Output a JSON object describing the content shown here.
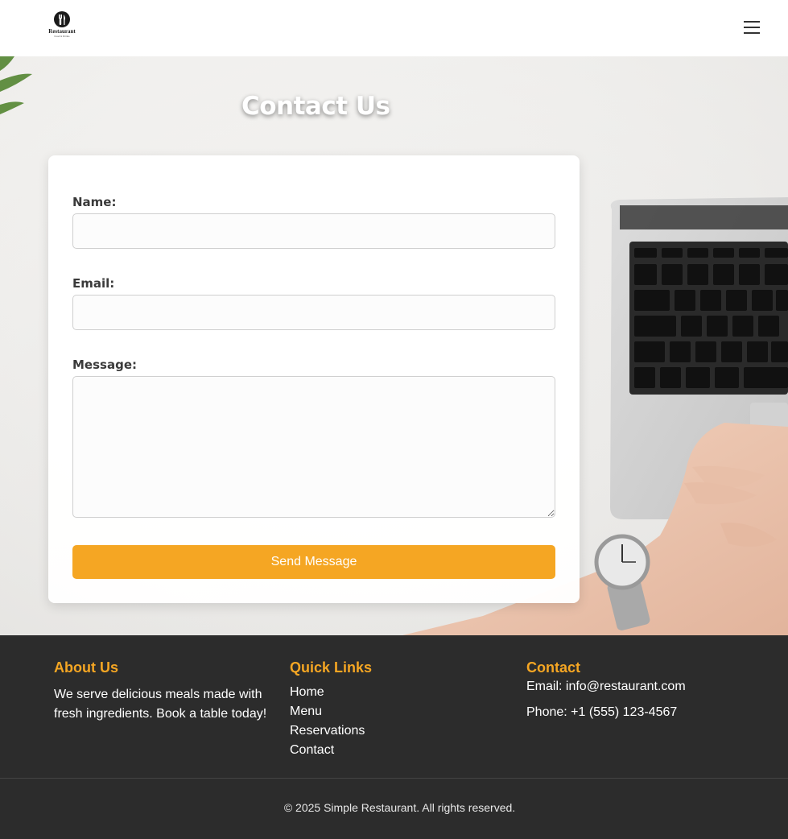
{
  "header": {
    "logo_text": "Restaurant",
    "logo_subtext": "Food & Drinks",
    "menu_icon": "hamburger-menu-icon"
  },
  "hero": {
    "title": "Contact Us"
  },
  "form": {
    "name_label": "Name:",
    "name_value": "",
    "email_label": "Email:",
    "email_value": "",
    "message_label": "Message:",
    "message_value": "",
    "submit_label": "Send Message"
  },
  "footer": {
    "about": {
      "title": "About Us",
      "text": "We serve delicious meals made with fresh ingredients. Book a table today!"
    },
    "quick_links": {
      "title": "Quick Links",
      "items": [
        "Home",
        "Menu",
        "Reservations",
        "Contact"
      ]
    },
    "contact": {
      "title": "Contact",
      "email": "Email: info@restaurant.com",
      "phone": "Phone: +1 (555) 123-4567"
    },
    "copyright": "© 2025 Simple Restaurant. All rights reserved."
  },
  "colors": {
    "accent": "#f5a623",
    "footer_bg": "#2c2c2c"
  }
}
